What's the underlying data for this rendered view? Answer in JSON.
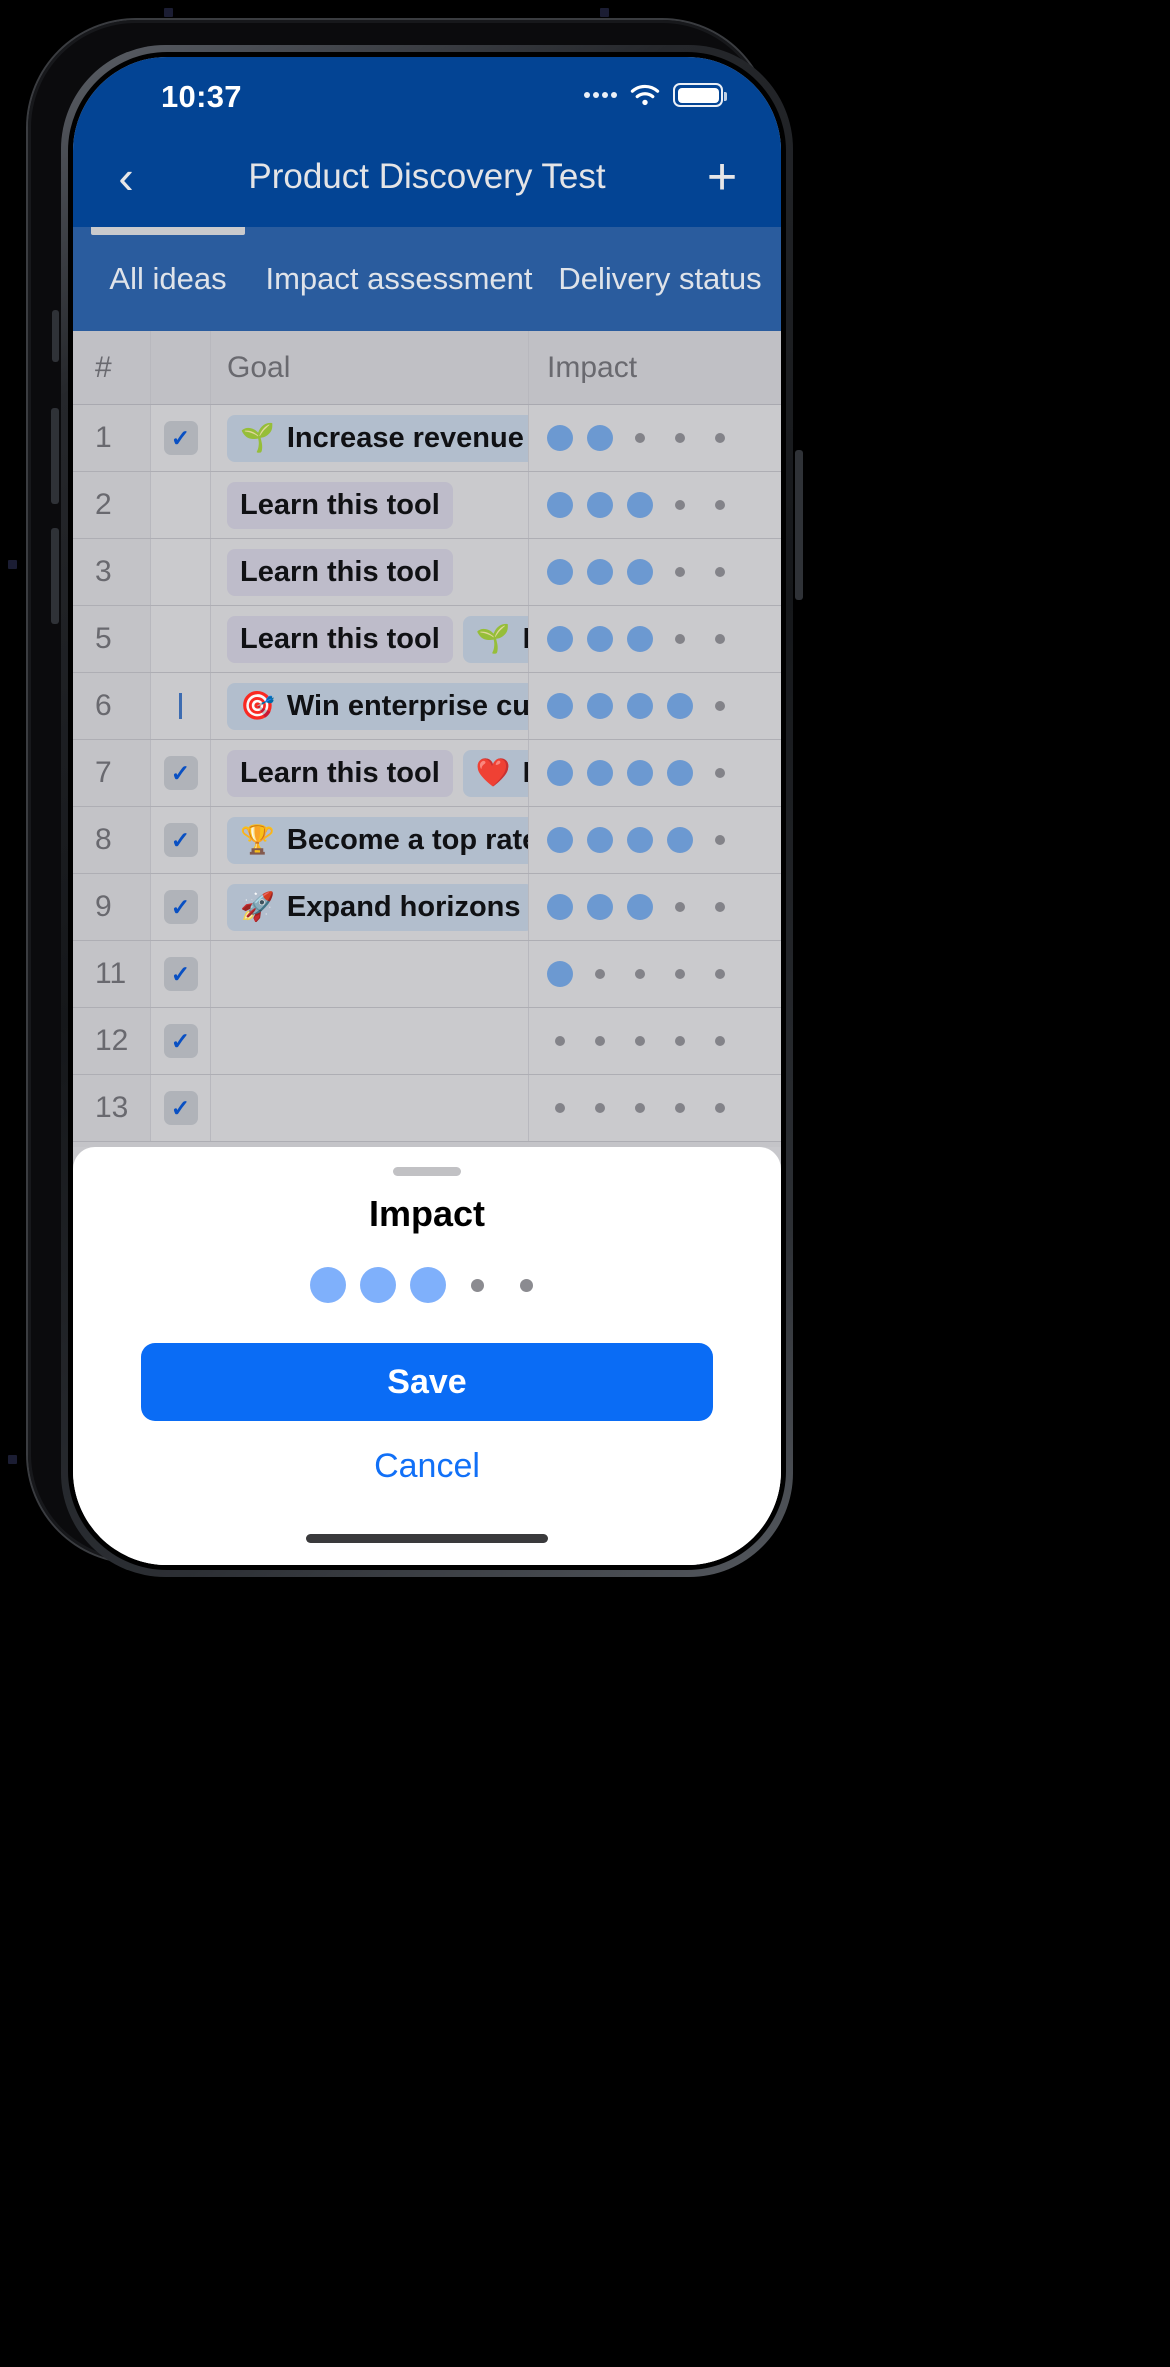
{
  "statusbar": {
    "time": "10:37",
    "signal_icon": "signal-dots-icon",
    "wifi_icon": "wifi-icon",
    "battery_icon": "battery-full-icon"
  },
  "navbar": {
    "back_icon": "‹",
    "title": "Product Discovery Test",
    "add_icon": "+"
  },
  "tabs": [
    {
      "label": "All ideas",
      "active": true
    },
    {
      "label": "Impact assessment",
      "active": false
    },
    {
      "label": "Delivery status",
      "active": false
    }
  ],
  "table": {
    "columns": [
      "#",
      "",
      "Goal",
      "Impact"
    ],
    "impact_scale": 5,
    "rows": [
      {
        "num": "1",
        "check": "checked",
        "tags": [
          {
            "emoji": "🌱",
            "text": "Increase revenue",
            "style": "blue"
          }
        ],
        "impact": 2
      },
      {
        "num": "2",
        "check": "none",
        "tags": [
          {
            "emoji": "",
            "text": "Learn this tool",
            "style": "plain"
          }
        ],
        "impact": 3
      },
      {
        "num": "3",
        "check": "none",
        "tags": [
          {
            "emoji": "",
            "text": "Learn this tool",
            "style": "plain"
          }
        ],
        "impact": 3
      },
      {
        "num": "5",
        "check": "none",
        "tags": [
          {
            "emoji": "",
            "text": "Learn this tool",
            "style": "plain"
          },
          {
            "emoji": "🌱",
            "text": "Inc",
            "style": "blue"
          }
        ],
        "impact": 3
      },
      {
        "num": "6",
        "check": "bar",
        "tags": [
          {
            "emoji": "🎯",
            "text": "Win enterprise cust",
            "style": "blue"
          }
        ],
        "impact": 4
      },
      {
        "num": "7",
        "check": "checked",
        "tags": [
          {
            "emoji": "",
            "text": "Learn this tool",
            "style": "plain"
          },
          {
            "emoji": "❤️",
            "text": "Del",
            "style": "blue"
          }
        ],
        "impact": 4
      },
      {
        "num": "8",
        "check": "checked",
        "tags": [
          {
            "emoji": "🏆",
            "text": "Become a top rated",
            "style": "blue"
          }
        ],
        "impact": 4
      },
      {
        "num": "9",
        "check": "checked",
        "tags": [
          {
            "emoji": "🚀",
            "text": "Expand horizons",
            "style": "blue"
          }
        ],
        "impact": 3
      },
      {
        "num": "11",
        "check": "checked",
        "tags": [],
        "impact": 1
      },
      {
        "num": "12",
        "check": "checked",
        "tags": [],
        "impact": 0
      },
      {
        "num": "13",
        "check": "checked",
        "tags": [],
        "impact": 0
      }
    ]
  },
  "sheet": {
    "title": "Impact",
    "rating_filled": 3,
    "rating_total": 5,
    "save_label": "Save",
    "cancel_label": "Cancel"
  },
  "colors": {
    "statusbar_blue": "#034494",
    "tabbar_blue": "#2a5c9e",
    "accent_blue": "#0a6cf5",
    "link_blue": "#1170f7",
    "dot_blue": "#6f9dd6",
    "sheet_dot_blue": "#7fb0fb",
    "table_bg": "#c8c8cc"
  }
}
